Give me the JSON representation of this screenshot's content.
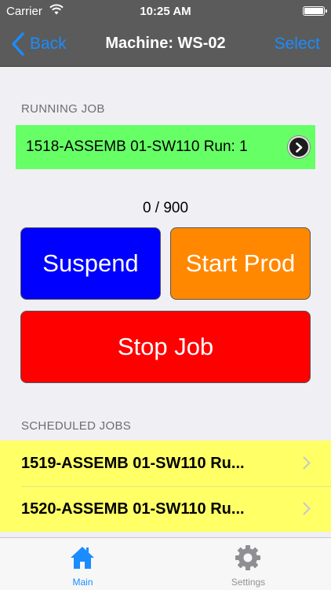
{
  "status_bar": {
    "carrier": "Carrier",
    "time": "10:25 AM",
    "wifi_icon": "wifi-icon",
    "battery_icon": "battery-icon"
  },
  "nav": {
    "back_label": "Back",
    "title": "Machine: WS-02",
    "select_label": "Select"
  },
  "running": {
    "header": "RUNNING JOB",
    "job_text": "1518-ASSEMB 01-SW110 Run: 1",
    "background": "#66ff66"
  },
  "counter": {
    "text": "0 / 900"
  },
  "actions": {
    "suspend_label": "Suspend",
    "suspend_color": "#0000ff",
    "start_prod_label": "Start Prod",
    "start_prod_color": "#ff8800",
    "stop_job_label": "Stop Job",
    "stop_job_color": "#ff0000"
  },
  "scheduled": {
    "header": "SCHEDULED JOBS",
    "background": "#ffff66",
    "items": [
      {
        "label": "1519-ASSEMB 01-SW110 Ru..."
      },
      {
        "label": "1520-ASSEMB 01-SW110 Ru..."
      }
    ]
  },
  "tabs": [
    {
      "label": "Main",
      "icon": "home-icon",
      "selected": true
    },
    {
      "label": "Settings",
      "icon": "gear-icon",
      "selected": false
    }
  ],
  "accent_color": "#1a8cff"
}
